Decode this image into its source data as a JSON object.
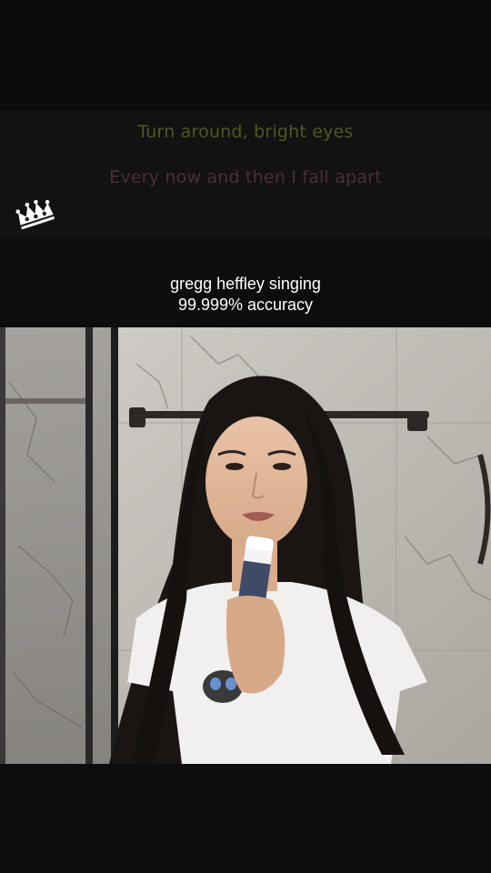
{
  "lyrics": {
    "current_line": "Turn around, bright eyes",
    "next_line": "Every now and then I fall apart"
  },
  "caption": {
    "line1": "gregg heffley singing",
    "line2": "99.999% accuracy"
  },
  "colors": {
    "current_lyric": "#4b5a24",
    "next_lyric": "#4d2e33",
    "caption_text": "#ffffff",
    "background": "#0d0d0d"
  },
  "icons": {
    "logo": "crown-icon"
  }
}
